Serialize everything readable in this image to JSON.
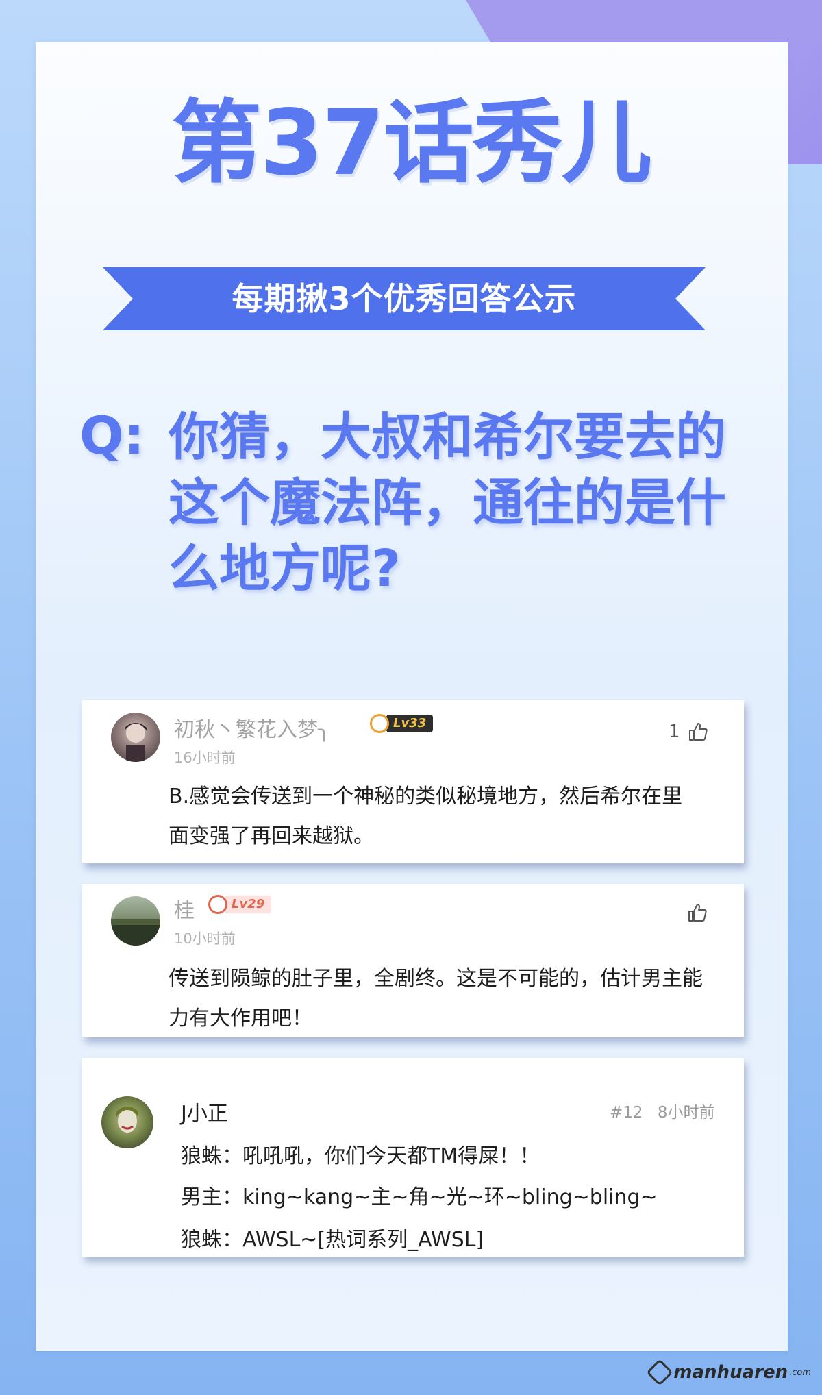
{
  "poster": {
    "title": "第37话秀儿",
    "banner": "每期揪3个优秀回答公示",
    "question_prefix": "Q:",
    "question": "你猜，大叔和希尔要去的这个魔法阵，通往的是什么地方呢?"
  },
  "colors": {
    "accent": "#5a78f0",
    "ribbon": "#4f72ec",
    "corner": "#9d92ee"
  },
  "comments": [
    {
      "username": "初秋丶繁花入梦╮",
      "level": "Lv33",
      "time": "16小时前",
      "likes": "1",
      "text": "B.感觉会传送到一个神秘的类似秘境地方，然后希尔在里面变强了再回来越狱。"
    },
    {
      "username": "桂",
      "level": "Lv29",
      "time": "10小时前",
      "likes": "",
      "text": "传送到陨鲸的肚子里，全剧终。这是不可能的，估计男主能力有大作用吧！"
    },
    {
      "username": "J小正",
      "floor": "#12",
      "time": "8小时前",
      "lines": [
        "狼蛛：吼吼吼，你们今天都TM得屎！！",
        "男主：king~kang~主~角~光~环~bling~bling~",
        "狼蛛：AWSL~[热词系列_AWSL]"
      ]
    }
  ],
  "icons": {
    "like": "thumbs-up-icon",
    "level_badge": "level-face-icon",
    "watermark_logo": "manhuaren-logo-icon"
  },
  "watermark": {
    "text": "manhuaren",
    "suffix": ".com"
  }
}
